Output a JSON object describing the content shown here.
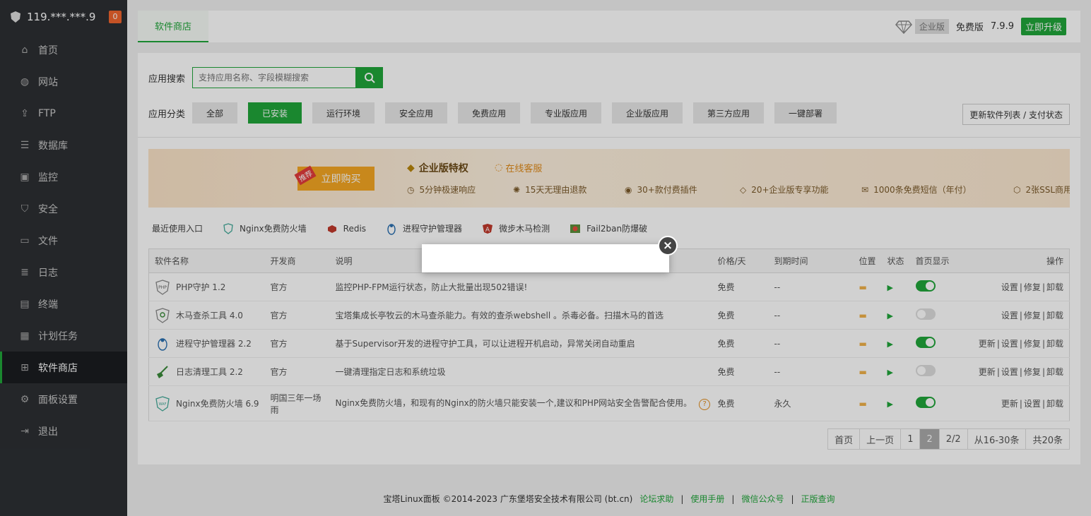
{
  "sidebar": {
    "host": "119.***.***.9",
    "badge": "0",
    "items": [
      {
        "label": "首页",
        "icon": "home-icon"
      },
      {
        "label": "网站",
        "icon": "globe-icon"
      },
      {
        "label": "FTP",
        "icon": "ftp-icon"
      },
      {
        "label": "数据库",
        "icon": "database-icon"
      },
      {
        "label": "监控",
        "icon": "monitor-icon"
      },
      {
        "label": "安全",
        "icon": "shield-icon"
      },
      {
        "label": "文件",
        "icon": "folder-icon"
      },
      {
        "label": "日志",
        "icon": "log-icon"
      },
      {
        "label": "终端",
        "icon": "terminal-icon"
      },
      {
        "label": "计划任务",
        "icon": "calendar-icon"
      },
      {
        "label": "软件商店",
        "icon": "apps-icon"
      },
      {
        "label": "面板设置",
        "icon": "gear-icon"
      },
      {
        "label": "退出",
        "icon": "logout-icon"
      }
    ]
  },
  "topbar": {
    "tab": "软件商店",
    "enterprise": "企业版",
    "free_label": "免费版",
    "version": "7.9.9",
    "upgrade": "立即升级"
  },
  "search": {
    "label": "应用搜索",
    "placeholder": "支持应用名称、字段模糊搜索"
  },
  "categories": {
    "label": "应用分类",
    "items": [
      "全部",
      "已安装",
      "运行环境",
      "安全应用",
      "免费应用",
      "专业版应用",
      "企业版应用",
      "第三方应用",
      "一键部署"
    ],
    "refresh": "更新软件列表 / 支付状态"
  },
  "banner": {
    "tag": "推荐",
    "buy": "立即购买",
    "title": "企业版特权",
    "online": "在线客服",
    "features": [
      "5分钟极速响应",
      "15天无理由退款",
      "30+款付费插件",
      "20+企业版专享功能",
      "1000条免费短信（年付）",
      "2张SSL商用"
    ]
  },
  "recent": {
    "label": "最近使用入口",
    "items": [
      "Nginx免费防火墙",
      "Redis",
      "进程守护管理器",
      "微步木马检测",
      "Fail2ban防爆破"
    ]
  },
  "table": {
    "headers": [
      "软件名称",
      "开发商",
      "说明",
      "价格/天",
      "到期时间",
      "位置",
      "状态",
      "首页显示",
      "操作"
    ],
    "rows": [
      {
        "name": "PHP守护 1.2",
        "dev": "官方",
        "desc": "监控PHP-FPM运行状态，防止大批量出现502错误!",
        "price": "免费",
        "expire": "--",
        "ops": [
          "设置",
          "修复",
          "卸载"
        ],
        "on": true
      },
      {
        "name": "木马查杀工具 4.0",
        "dev": "官方",
        "desc": "宝塔集成长亭牧云的木马查杀能力。有效的查杀webshell 。杀毒必备。扫描木马的首选",
        "price": "免费",
        "expire": "--",
        "ops": [
          "设置",
          "修复",
          "卸载"
        ],
        "on": false
      },
      {
        "name": "进程守护管理器 2.2",
        "dev": "官方",
        "desc": "基于Supervisor开发的进程守护工具，可以让进程开机启动，异常关闭自动重启",
        "price": "免费",
        "expire": "--",
        "ops": [
          "更新",
          "设置",
          "修复",
          "卸载"
        ],
        "on": true
      },
      {
        "name": "日志清理工具 2.2",
        "dev": "官方",
        "desc": "一键清理指定日志和系统垃圾",
        "price": "免费",
        "expire": "--",
        "ops": [
          "更新",
          "设置",
          "修复",
          "卸载"
        ],
        "on": false
      },
      {
        "name": "Nginx免费防火墙 6.9",
        "dev": "明国三年一场雨",
        "desc": "Nginx免费防火墙，和现有的Nginx的防火墙只能安装一个,建议和PHP网站安全告警配合使用。",
        "price": "免费",
        "expire": "永久",
        "ops": [
          "更新",
          "设置",
          "卸载"
        ],
        "on": true
      }
    ]
  },
  "pager": [
    "首页",
    "上一页",
    "1",
    "2",
    "2/2",
    "从16-30条",
    "共20条"
  ],
  "footer": {
    "copyright": "宝塔Linux面板 ©2014-2023 广东堡塔安全技术有限公司 (bt.cn)",
    "links": [
      "论坛求助",
      "使用手册",
      "微信公众号",
      "正版查询"
    ]
  },
  "colors": {
    "accent": "#20a53a",
    "sidebar": "#2c2f33"
  }
}
